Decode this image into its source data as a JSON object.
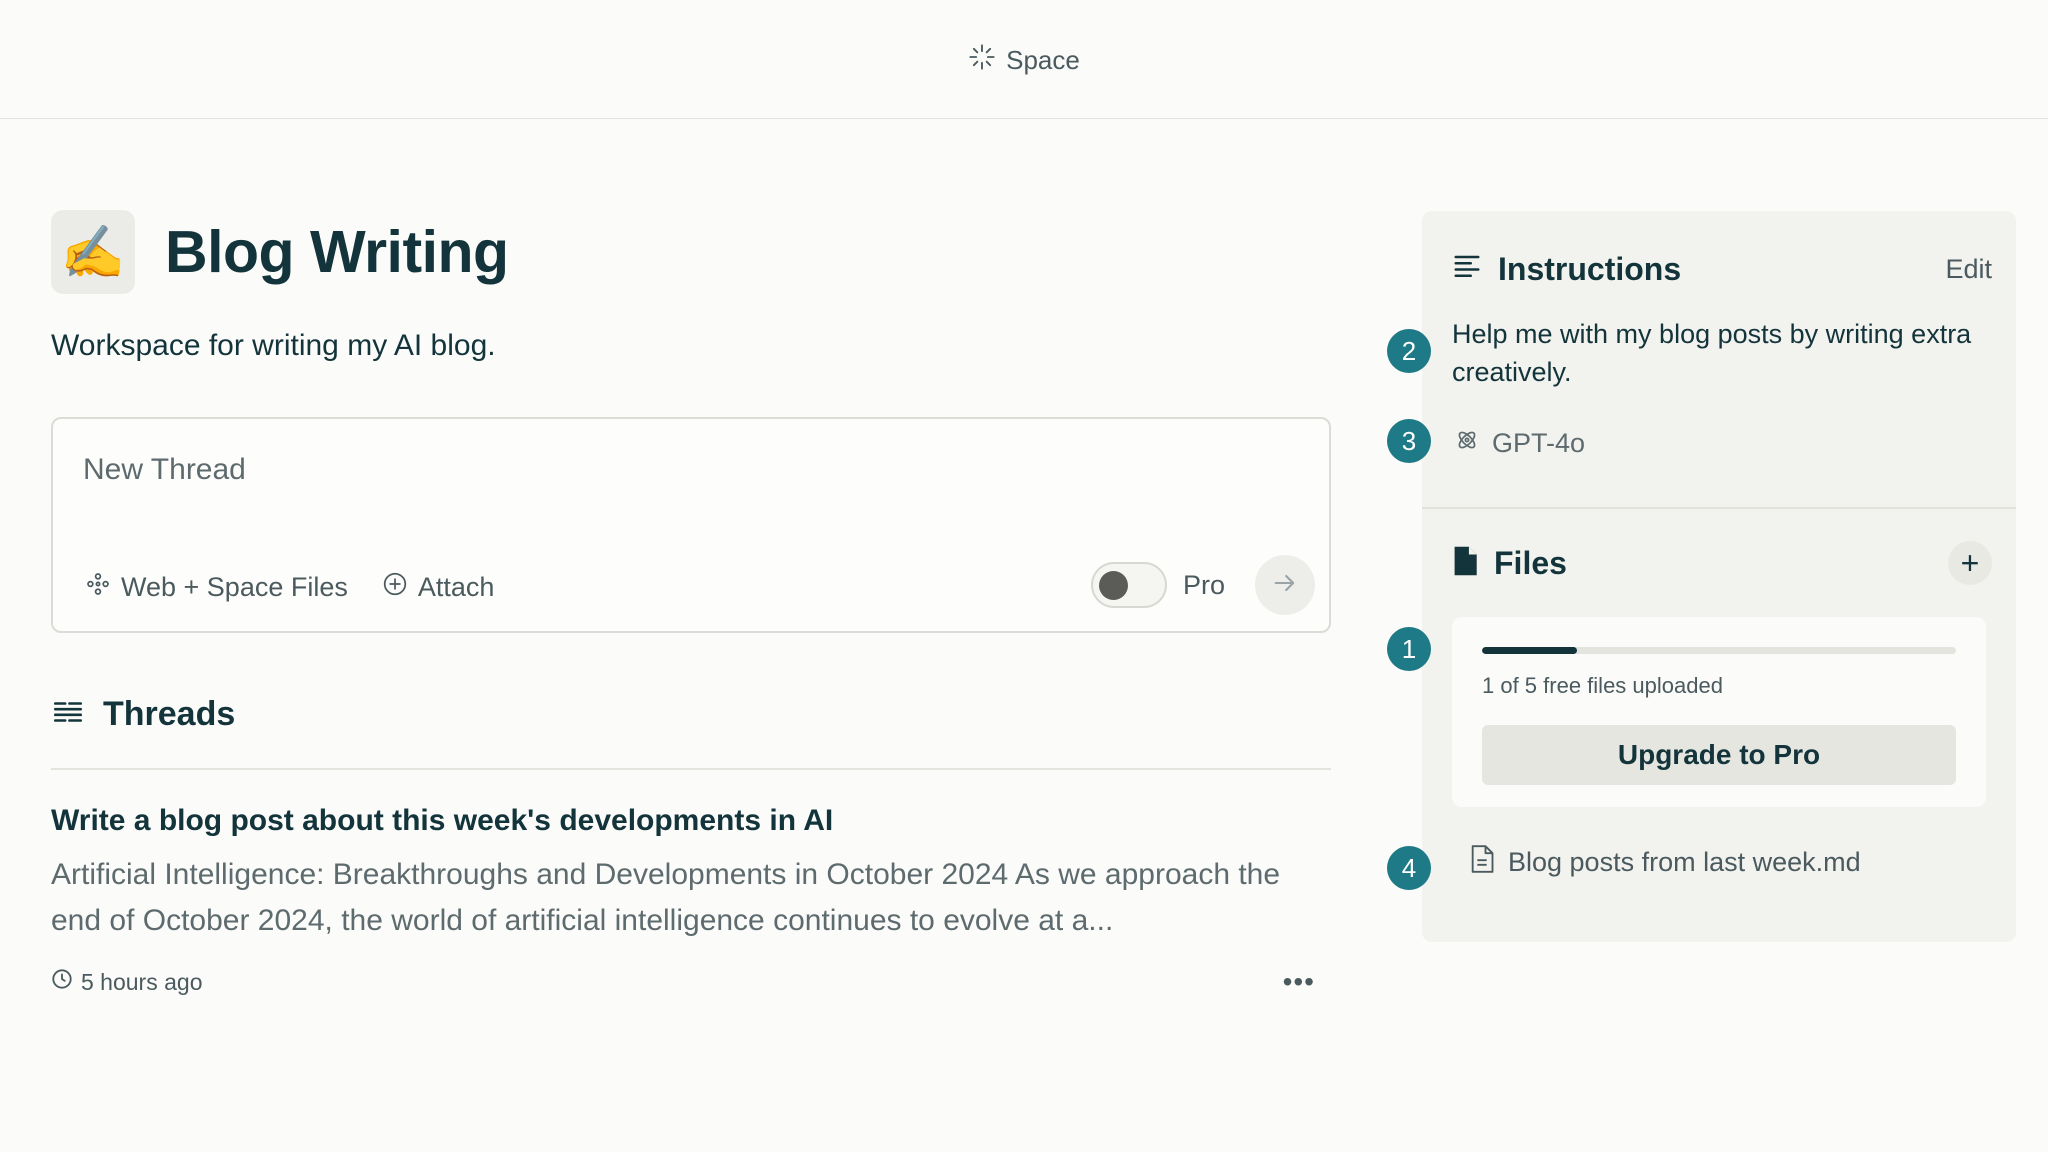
{
  "topbar": {
    "label": "Space"
  },
  "space": {
    "emoji": "✍️",
    "title": "Blog Writing",
    "description": "Workspace for writing my AI blog."
  },
  "composer": {
    "placeholder": "New Thread",
    "sources_label": "Web + Space Files",
    "attach_label": "Attach",
    "pro_label": "Pro",
    "pro_enabled": false
  },
  "threads": {
    "header": "Threads",
    "items": [
      {
        "title": "Write a blog post about this week's developments in AI",
        "snippet": "Artificial Intelligence: Breakthroughs and Developments in October 2024 As we approach the end of October 2024, the world of artificial intelligence continues to evolve at a...",
        "time": "5 hours ago",
        "more": "•••"
      }
    ]
  },
  "instructions": {
    "title": "Instructions",
    "edit_label": "Edit",
    "text": "Help me with my blog posts by writing extra creatively.",
    "model": "GPT-4o"
  },
  "files": {
    "title": "Files",
    "add_label": "+",
    "uploaded": 1,
    "limit": 5,
    "progress_fraction": 0.2,
    "upload_status": "1 of 5 free files uploaded",
    "upgrade_label": "Upgrade to Pro",
    "items": [
      {
        "name": "Blog posts from last week.md"
      }
    ]
  },
  "annotations": [
    "1",
    "2",
    "3",
    "4"
  ],
  "colors": {
    "background": "#fbfbf9",
    "panel": "#f2f2ee",
    "text_primary": "#13343b",
    "text_secondary": "#5e6b6e",
    "badge": "#1e7a86"
  }
}
